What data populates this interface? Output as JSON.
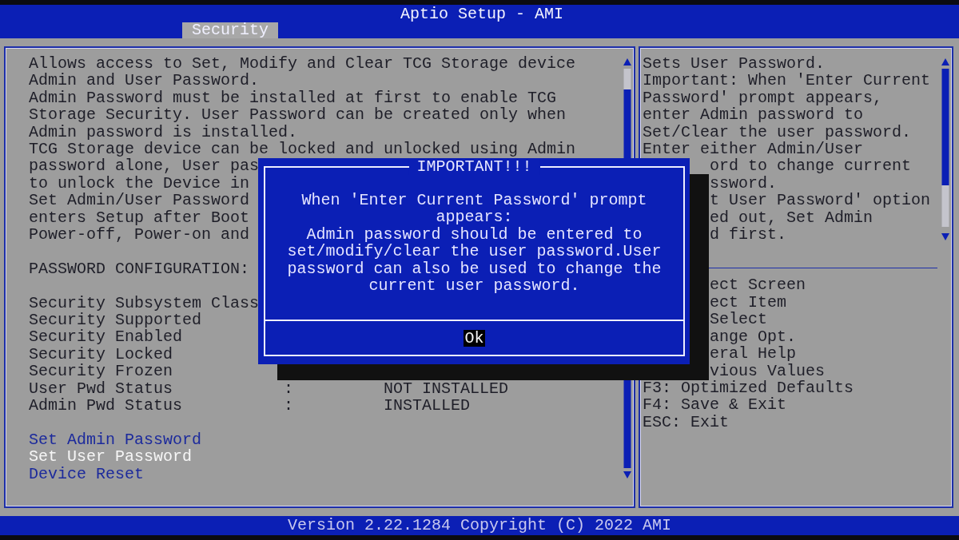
{
  "window": {
    "title": "Aptio Setup - AMI"
  },
  "tabs": [
    {
      "label": "Security",
      "selected": true
    }
  ],
  "left_panel": {
    "description_lines": [
      "Allows access to Set, Modify and Clear TCG Storage device",
      "Admin and User Password.",
      "Admin Password must be installed at first to enable TCG",
      "Storage Security. User Password can be created only when",
      "Admin password is installed.",
      "TCG Storage device can be locked and unlocked using Admin",
      "password alone, User pas",
      "to unlock the Device in",
      "Set Admin/User Password",
      "enters Setup after Boot",
      "Power-off, Power-on and"
    ],
    "section_heading": "PASSWORD CONFIGURATION:",
    "status_rows": [
      {
        "label": "Security Subsystem Class"
      },
      {
        "label": "Security Supported"
      },
      {
        "label": "Security Enabled"
      },
      {
        "label": "Security Locked"
      },
      {
        "label": "Security Frozen"
      },
      {
        "label": "User Pwd Status",
        "separator": ":",
        "value": "NOT INSTALLED"
      },
      {
        "label": "Admin Pwd Status",
        "separator": ":",
        "value": "INSTALLED"
      }
    ],
    "menu_items": [
      {
        "label": "Set Admin Password",
        "selected": false
      },
      {
        "label": "Set User Password",
        "selected": true
      },
      {
        "label": "Device Reset",
        "selected": false
      }
    ]
  },
  "right_panel": {
    "description_lines": [
      {
        "text": "Sets User Password.",
        "covered": false
      },
      {
        "text": "Important: When 'Enter Current",
        "covered": false
      },
      {
        "text": "Password' prompt appears,",
        "covered": false
      },
      {
        "text": "enter Admin password to",
        "covered": false
      },
      {
        "text": "Set/Clear the user password.",
        "covered": false
      },
      {
        "text": "Enter either Admin/User",
        "covered": false
      },
      {
        "text": "ord to change current",
        "covered": true
      },
      {
        "text": "ssword.",
        "covered": true
      },
      {
        "text": "t User Password' option",
        "covered": true
      },
      {
        "text": "ed out, Set Admin",
        "covered": true
      },
      {
        "text": "d first.",
        "covered": true
      }
    ],
    "key_hints": [
      {
        "text": "ect Screen",
        "covered": true
      },
      {
        "text": "ect Item",
        "covered": true
      },
      {
        "text": "Select",
        "covered": true
      },
      {
        "text": "ange Opt.",
        "covered": true
      },
      {
        "text": "eral Help",
        "covered": true
      },
      {
        "text": "vious Values",
        "covered": true
      },
      {
        "text": "F3: Optimized Defaults",
        "covered": false
      },
      {
        "text": "F4: Save & Exit",
        "covered": false
      },
      {
        "text": "ESC: Exit",
        "covered": false
      }
    ]
  },
  "dialog": {
    "title": "IMPORTANT!!!",
    "message_lines": [
      "When 'Enter Current Password' prompt",
      "appears:",
      "Admin password should be entered to",
      "set/modify/clear the user password.User",
      "password can also be used to change the",
      "current user password."
    ],
    "button": {
      "label": "Ok",
      "selected": true
    }
  },
  "footer": "Version 2.22.1284 Copyright (C) 2022 AMI"
}
